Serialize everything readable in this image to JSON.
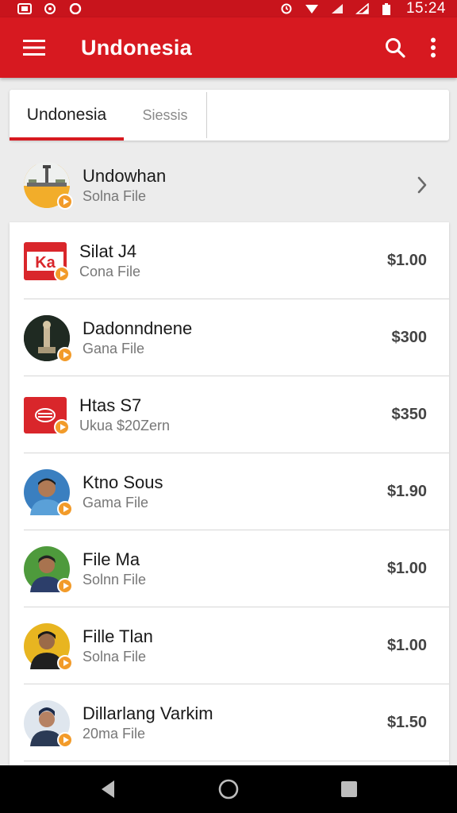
{
  "status_bar": {
    "time": "15:24"
  },
  "app_bar": {
    "title": "Undonesia"
  },
  "tabs": [
    {
      "label": "Undonesia",
      "active": true
    },
    {
      "label": "Siessis",
      "active": false
    }
  ],
  "featured": {
    "title": "Undowhan",
    "subtitle": "Solna File"
  },
  "items": [
    {
      "title": "Silat J4",
      "subtitle": "Cona File",
      "price": "$1.00",
      "icon": "ka-logo"
    },
    {
      "title": "Dadonndnene",
      "subtitle": "Gana File",
      "price": "$300",
      "icon": "statue"
    },
    {
      "title": "Htas S7",
      "subtitle": "Ukua $20Zern",
      "price": "$350",
      "icon": "red-logo"
    },
    {
      "title": "Ktno Sous",
      "subtitle": "Gama File",
      "price": "$1.90",
      "icon": "person"
    },
    {
      "title": "File Ma",
      "subtitle": "Solnn File",
      "price": "$1.00",
      "icon": "person"
    },
    {
      "title": "Fille Tlan",
      "subtitle": "Solna File",
      "price": "$1.00",
      "icon": "person"
    },
    {
      "title": "Dillarlang Varkim",
      "subtitle": "20ma File",
      "price": "$1.50",
      "icon": "person"
    }
  ],
  "colors": {
    "primary": "#d71920",
    "status": "#c8141c",
    "badge": "#f29b2a"
  }
}
